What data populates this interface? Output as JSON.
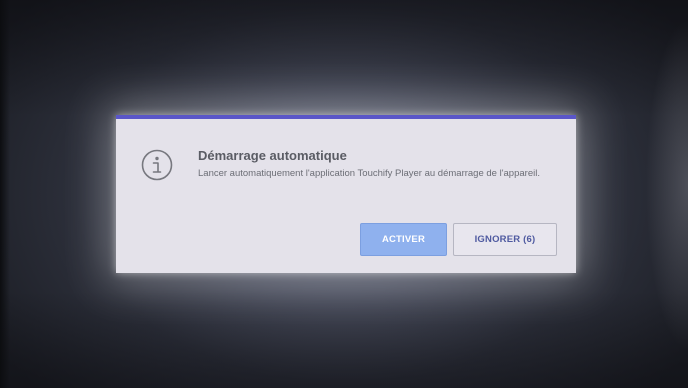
{
  "dialog": {
    "title": "Démarrage automatique",
    "message": "Lancer automatiquement l'application Touchify Player au démarrage de l'appareil.",
    "icon": "info-icon",
    "accent_color": "#5a56c8",
    "primary_button": {
      "label": "ACTIVER",
      "color": "#8fb1ee"
    },
    "secondary_button": {
      "label": "IGNORER (6)"
    }
  }
}
